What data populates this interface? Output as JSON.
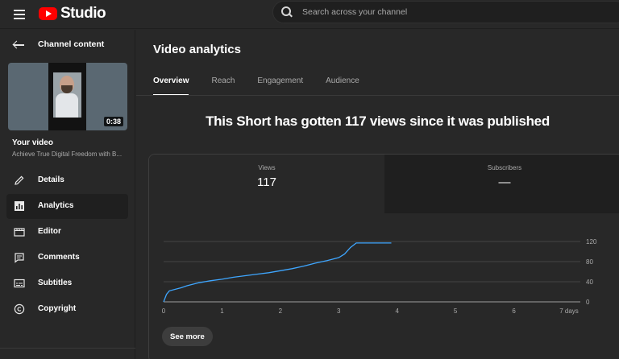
{
  "header": {
    "app_name": "Studio",
    "search_placeholder": "Search across your channel"
  },
  "sidebar": {
    "back_label": "Channel content",
    "video": {
      "duration": "0:38",
      "heading": "Your video",
      "title": "Achieve True Digital Freedom with B..."
    },
    "items": [
      {
        "label": "Details",
        "icon": "pencil-icon",
        "active": false
      },
      {
        "label": "Analytics",
        "icon": "analytics-icon",
        "active": true
      },
      {
        "label": "Editor",
        "icon": "clapperboard-icon",
        "active": false
      },
      {
        "label": "Comments",
        "icon": "comments-icon",
        "active": false
      },
      {
        "label": "Subtitles",
        "icon": "subtitles-icon",
        "active": false
      },
      {
        "label": "Copyright",
        "icon": "copyright-icon",
        "active": false
      }
    ]
  },
  "main": {
    "title": "Video analytics",
    "tabs": [
      {
        "label": "Overview",
        "active": true
      },
      {
        "label": "Reach",
        "active": false
      },
      {
        "label": "Engagement",
        "active": false
      },
      {
        "label": "Audience",
        "active": false
      }
    ],
    "headline": "This Short has gotten 117 views since it was published",
    "metrics": {
      "views": {
        "label": "Views",
        "value": "117"
      },
      "subscribers": {
        "label": "Subscribers",
        "value": "—"
      }
    },
    "see_more_label": "See more"
  },
  "colors": {
    "accent_line": "#3ea6ff",
    "brand_red": "#ff0000"
  },
  "chart_data": {
    "type": "line",
    "x_ticks": [
      "0",
      "1",
      "2",
      "3",
      "4",
      "5",
      "6",
      "7 days"
    ],
    "y_ticks": [
      "0",
      "40",
      "80",
      "120"
    ],
    "xlim": [
      0,
      7
    ],
    "ylim": [
      0,
      120
    ],
    "series": [
      {
        "x": [
          0,
          0.05,
          0.1,
          0.3,
          0.4,
          0.6,
          0.8,
          1.0,
          1.2,
          1.4,
          1.6,
          1.8,
          2.0,
          2.2,
          2.4,
          2.6,
          2.8,
          3.0,
          3.1,
          3.2,
          3.3,
          3.9
        ],
        "y": [
          0,
          15,
          22,
          28,
          32,
          38,
          42,
          45,
          49,
          52,
          55,
          58,
          62,
          66,
          71,
          77,
          82,
          88,
          95,
          108,
          117,
          117
        ]
      }
    ]
  }
}
